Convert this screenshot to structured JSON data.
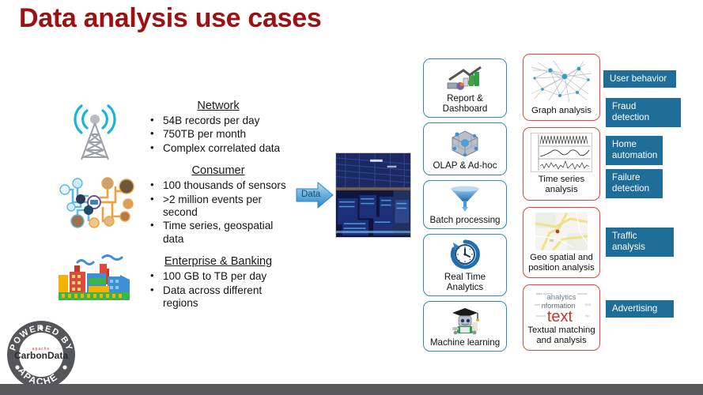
{
  "slide": {
    "title": "Data analysis use cases",
    "title_color": "#9c1111",
    "background": "#ffffff",
    "footer_color": "#59595b"
  },
  "sources": [
    {
      "icon": "cell-tower-icon",
      "heading": "Network",
      "bullets": [
        "54B records per day",
        "750TB per month",
        "Complex correlated data"
      ]
    },
    {
      "icon": "iot-network-icon",
      "heading": "Consumer",
      "bullets": [
        "100 thousands of sensors",
        ">2 million events per second",
        "Time series, geospatial data"
      ]
    },
    {
      "icon": "factory-icon",
      "heading": "Enterprise & Banking",
      "bullets": [
        "100 GB to TB per day",
        "Data across different regions"
      ]
    }
  ],
  "flow": {
    "arrow_label": "Data",
    "arrow_color": "#4f9fd4",
    "photo_alt": "data-center-photo"
  },
  "processing_cards": {
    "border_color": "#2e86c1",
    "items": [
      {
        "label": "Report & Dashboard",
        "icon": "bar-chart-report-icon"
      },
      {
        "label": "OLAP & Ad-hoc",
        "icon": "olap-cube-icon"
      },
      {
        "label": "Batch processing",
        "icon": "funnel-icon"
      },
      {
        "label": "Real Time Analytics",
        "icon": "clock-refresh-icon"
      },
      {
        "label": "Machine learning",
        "icon": "graduate-robot-icon"
      }
    ]
  },
  "analysis_cards": {
    "border_color": "#e0493a",
    "items": [
      {
        "label": "Graph analysis",
        "icon": "network-graph-icon"
      },
      {
        "label": "Time series analysis",
        "icon": "time-series-plot-icon"
      },
      {
        "label": "Geo spatial and position analysis",
        "icon": "map-icon"
      },
      {
        "label": "Textual matching and analysis",
        "icon": "word-cloud-icon"
      }
    ]
  },
  "use_case_badges": {
    "color": "#1f6d99",
    "items": [
      "User behavior",
      "Fraud detection",
      "Home automation",
      "Failure detection",
      "Traffic analysis",
      "Advertising"
    ]
  },
  "logo": {
    "top_text": "POWERED BY",
    "bottom_text": "APACHE",
    "brand": "CarbonData",
    "brand_sub": "apache"
  }
}
